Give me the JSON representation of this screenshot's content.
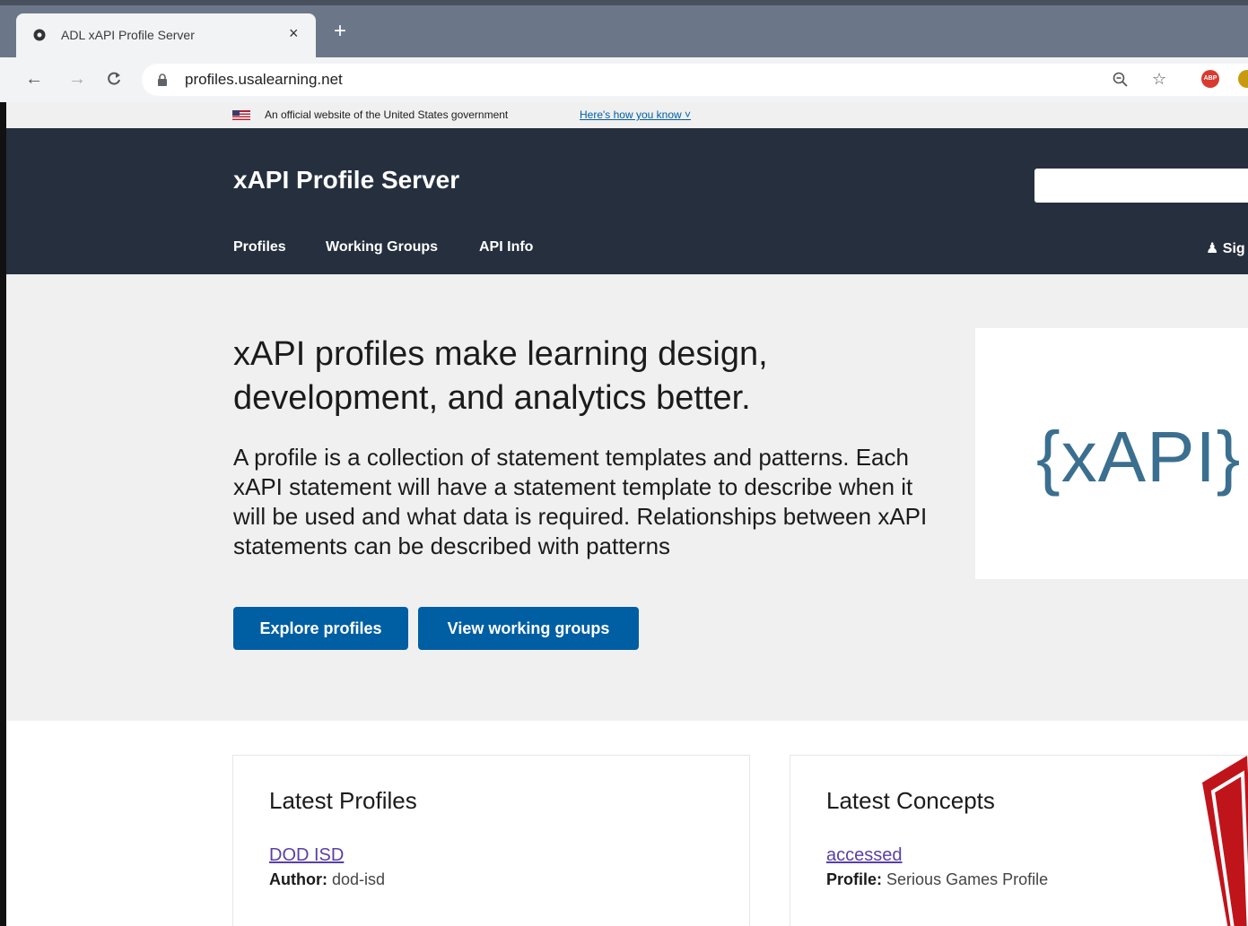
{
  "browser": {
    "tab_title": "ADL xAPI Profile Server",
    "tab_close": "×",
    "new_tab": "+",
    "url": "profiles.usalearning.net"
  },
  "gov_banner": {
    "text": "An official website of the United States government",
    "link": "Here's how you know"
  },
  "header": {
    "brand": "xAPI Profile Server",
    "nav": [
      "Profiles",
      "Working Groups",
      "API Info"
    ],
    "signin": "Sig"
  },
  "hero": {
    "title": "xAPI profiles make learning design, development, and analytics better.",
    "description": "A profile is a collection of statement templates and patterns. Each xAPI statement will have a statement template to describe when it will be used and what data is required. Relationships between xAPI statements can be described with patterns",
    "buttons": {
      "explore": "Explore profiles",
      "working_groups": "View working groups"
    },
    "logo_text": "{xAPI}"
  },
  "latest_profiles": {
    "heading": "Latest Profiles",
    "items": [
      {
        "name": "DOD ISD",
        "meta_label": "Author:",
        "meta_value": "dod-isd"
      }
    ]
  },
  "latest_concepts": {
    "heading": "Latest Concepts",
    "items": [
      {
        "name": "accessed",
        "meta_label": "Profile:",
        "meta_value": "Serious Games Profile"
      }
    ]
  }
}
